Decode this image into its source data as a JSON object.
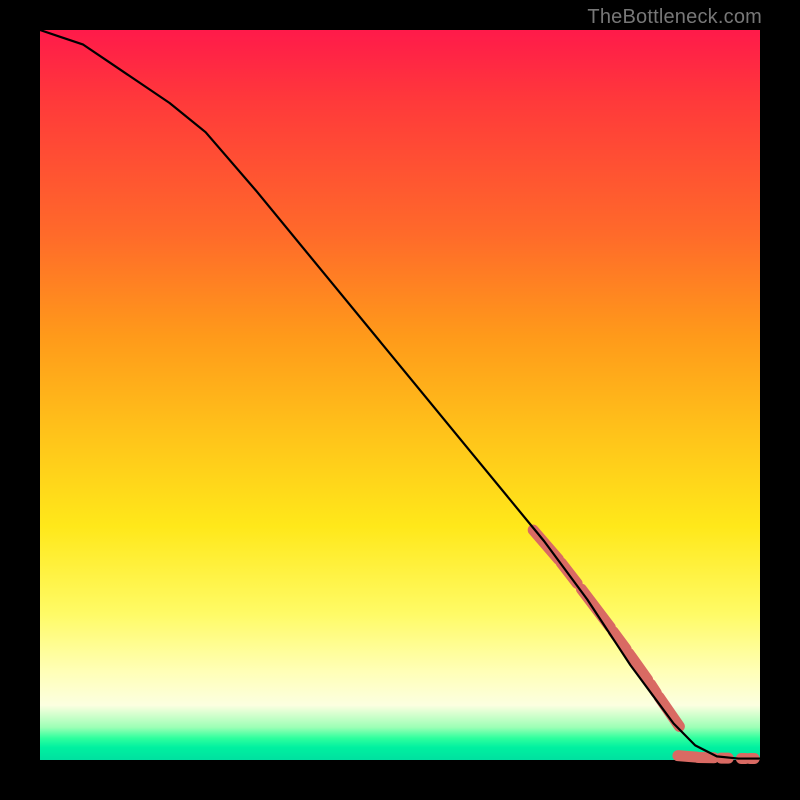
{
  "watermark": "TheBottleneck.com",
  "chart_data": {
    "type": "line",
    "title": "",
    "xlabel": "",
    "ylabel": "",
    "xlim": [
      0,
      100
    ],
    "ylim": [
      0,
      100
    ],
    "grid": false,
    "legend": false,
    "series": [
      {
        "name": "curve",
        "color": "#000000",
        "x": [
          0,
          3,
          6,
          9,
          12,
          15,
          18,
          23,
          30,
          40,
          50,
          60,
          70,
          76,
          80,
          82,
          85,
          88,
          91,
          94,
          97,
          100
        ],
        "y": [
          100,
          99,
          98,
          96,
          94,
          92,
          90,
          86,
          78,
          66,
          54,
          42,
          30,
          22,
          16,
          13,
          9,
          5,
          2,
          0.5,
          0.2,
          0.2
        ]
      }
    ],
    "markers": [
      {
        "name": "highlight-run-1",
        "color": "#d96a63",
        "shape": "pill",
        "points": [
          {
            "x_start": 68.5,
            "x_end": 72.0,
            "y_start": 31.5,
            "y_end": 27.5
          },
          {
            "x_start": 72.4,
            "x_end": 74.6,
            "y_start": 27.0,
            "y_end": 24.2
          },
          {
            "x_start": 75.2,
            "x_end": 79.2,
            "y_start": 23.4,
            "y_end": 18.2
          },
          {
            "x_start": 79.6,
            "x_end": 81.4,
            "y_start": 17.6,
            "y_end": 15.2
          },
          {
            "x_start": 81.8,
            "x_end": 84.4,
            "y_start": 14.6,
            "y_end": 11.0
          },
          {
            "x_start": 84.8,
            "x_end": 85.6,
            "y_start": 10.4,
            "y_end": 9.2
          },
          {
            "x_start": 86.0,
            "x_end": 88.8,
            "y_start": 8.6,
            "y_end": 4.6
          }
        ]
      },
      {
        "name": "highlight-baseline",
        "color": "#d96a63",
        "shape": "pill",
        "points": [
          {
            "x_start": 88.6,
            "x_end": 91.2,
            "y_start": 0.6,
            "y_end": 0.4
          },
          {
            "x_start": 91.4,
            "x_end": 93.6,
            "y_start": 0.35,
            "y_end": 0.3
          },
          {
            "x_start": 94.6,
            "x_end": 95.6,
            "y_start": 0.25,
            "y_end": 0.25
          },
          {
            "x_start": 97.4,
            "x_end": 98.0,
            "y_start": 0.2,
            "y_end": 0.2
          },
          {
            "x_start": 98.6,
            "x_end": 99.2,
            "y_start": 0.2,
            "y_end": 0.2
          }
        ]
      }
    ]
  }
}
